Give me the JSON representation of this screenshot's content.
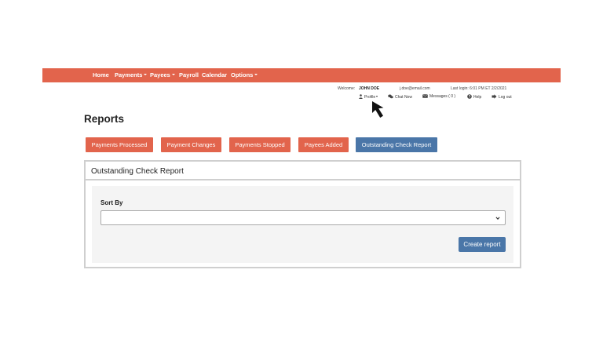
{
  "navbar": {
    "items": [
      {
        "label": "Home",
        "dropdown": false
      },
      {
        "label": "Payments",
        "dropdown": true
      },
      {
        "label": "Payees",
        "dropdown": true
      },
      {
        "label": "Payroll",
        "dropdown": false
      },
      {
        "label": "Calendar",
        "dropdown": false
      },
      {
        "label": "Options",
        "dropdown": true
      }
    ],
    "color": "#e2644c"
  },
  "user": {
    "welcome_label": "Welcome:",
    "name": "JOHN DOE",
    "email": "j.doe@email.com",
    "last_login": "Last login: 6:01 PM ET  2/2/2021"
  },
  "user_links": {
    "profile": {
      "label": "Profile",
      "icon": "user-icon"
    },
    "chat": {
      "label": "Chat Now",
      "icon": "chat-icon"
    },
    "messages": {
      "label": "Messages ( 0 )",
      "icon": "envelope-icon"
    },
    "help": {
      "label": "Help",
      "icon": "question-icon"
    },
    "logout": {
      "label": "Log out",
      "icon": "logout-icon"
    }
  },
  "page": {
    "title": "Reports"
  },
  "report_tabs": [
    {
      "label": "Payments Processed",
      "active": false
    },
    {
      "label": "Payment Changes",
      "active": false
    },
    {
      "label": "Payments Stopped",
      "active": false
    },
    {
      "label": "Payees Added",
      "active": false
    },
    {
      "label": "Outstanding Check Report",
      "active": true
    }
  ],
  "panel": {
    "title": "Outstanding Check Report",
    "sort_label": "Sort By",
    "sort_value": "",
    "create_label": "Create report"
  },
  "colors": {
    "primary_orange": "#e2644c",
    "primary_blue": "#4a76a8"
  }
}
